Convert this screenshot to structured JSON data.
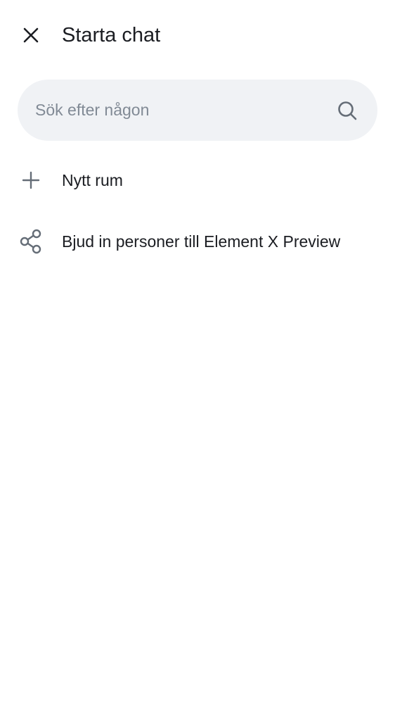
{
  "header": {
    "close_icon": "close-icon",
    "title": "Starta chat"
  },
  "search": {
    "placeholder": "Sök efter någon",
    "value": "",
    "icon": "search-icon"
  },
  "actions": [
    {
      "icon": "plus-icon",
      "label": "Nytt rum"
    },
    {
      "icon": "share-icon",
      "label": "Bjud in personer till Element X Preview"
    }
  ],
  "colors": {
    "background": "#ffffff",
    "search_background": "#f0f2f5",
    "icon": "#656d77",
    "text": "#1b1d22",
    "placeholder": "#818a95"
  }
}
